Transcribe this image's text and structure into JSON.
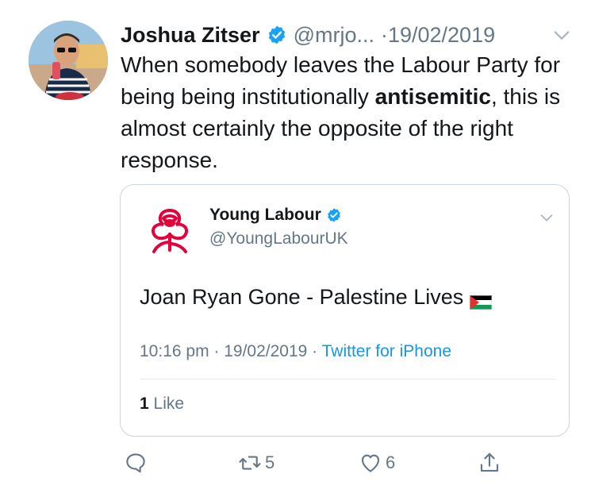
{
  "tweet": {
    "display_name": "Joshua Zitser",
    "handle": "@mrjo...",
    "date": "·19/02/2019",
    "text_part1": "When somebody leaves the Labour Party for being being institutionally ",
    "text_bold": "antisemitic",
    "text_part2": ", this is almost certainly the opposite of the right response."
  },
  "quote": {
    "display_name": "Young Labour",
    "handle": "@YoungLabourUK",
    "text": "Joan Ryan Gone - Palestine Lives",
    "time": "10:16 pm · 19/02/2019 · ",
    "source": "Twitter for iPhone",
    "likes_count": "1",
    "likes_label": " Like"
  },
  "actions": {
    "retweet_count": "5",
    "like_count": "6"
  },
  "colors": {
    "verified": "#1da1f2",
    "secondary_text": "#657786",
    "link": "#1b95e0",
    "labour_red": "#e4003b"
  }
}
